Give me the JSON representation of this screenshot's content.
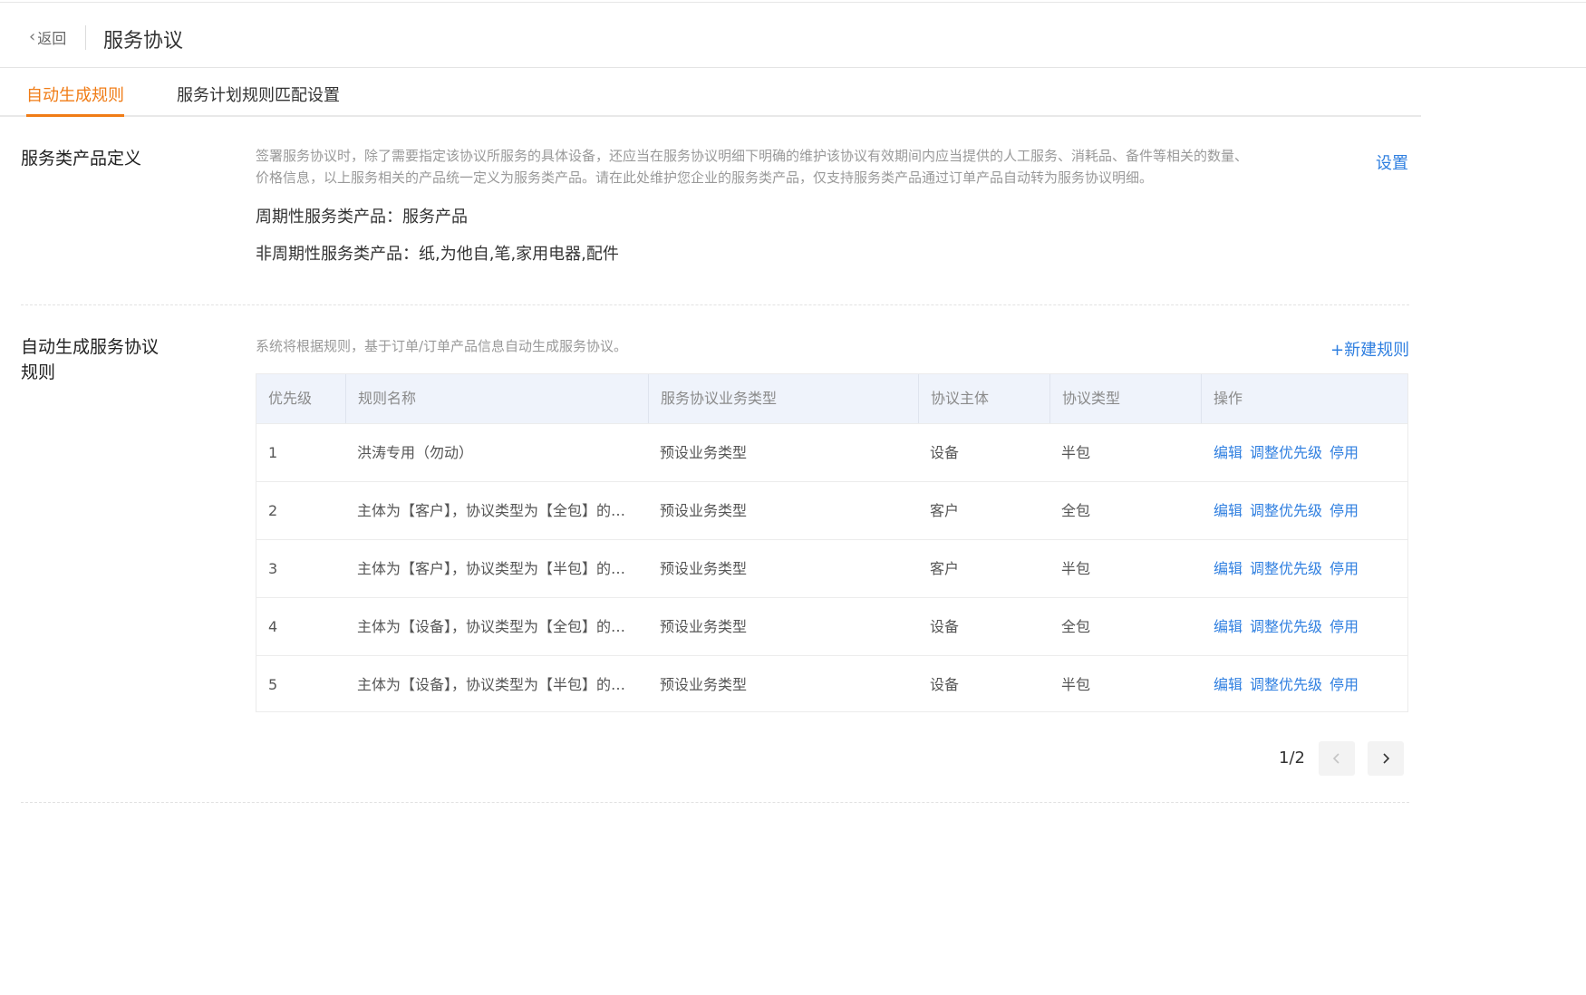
{
  "header": {
    "back_label": "返回",
    "title": "服务协议"
  },
  "tabs": [
    {
      "label": "自动生成规则",
      "active": true
    },
    {
      "label": "服务计划规则匹配设置",
      "active": false
    }
  ],
  "product_section": {
    "label": "服务类产品定义",
    "description_line1": "签署服务协议时，除了需要指定该协议所服务的具体设备，还应当在服务协议明细下明确的维护该协议有效期间内应当提供的人工服务、消耗品、备件等相关的数量、",
    "description_line2": "价格信息，以上服务相关的产品统一定义为服务类产品。请在此处维护您企业的服务类产品，仅支持服务类产品通过订单产品自动转为服务协议明细。",
    "settings_link": "设置",
    "periodic": "周期性服务类产品：服务产品",
    "non_periodic": "非周期性服务类产品：纸,为他自,笔,家用电器,配件"
  },
  "rules_section": {
    "label_line1": "自动生成服务协议",
    "label_line2": "规则",
    "description": "系统将根据规则，基于订单/订单产品信息自动生成服务协议。",
    "new_rule_link": "+新建规则",
    "columns": [
      "优先级",
      "规则名称",
      "服务协议业务类型",
      "协议主体",
      "协议类型",
      "操作"
    ],
    "rows": [
      {
        "priority": "1",
        "name": "洪涛专用（勿动）",
        "business_type": "预设业务类型",
        "subject": "设备",
        "type": "半包"
      },
      {
        "priority": "2",
        "name": "主体为【客户】，协议类型为【全包】的服务协议",
        "business_type": "预设业务类型",
        "subject": "客户",
        "type": "全包"
      },
      {
        "priority": "3",
        "name": "主体为【客户】，协议类型为【半包】的服务协议",
        "business_type": "预设业务类型",
        "subject": "客户",
        "type": "半包"
      },
      {
        "priority": "4",
        "name": "主体为【设备】，协议类型为【全包】的服务协议",
        "business_type": "预设业务类型",
        "subject": "设备",
        "type": "全包"
      },
      {
        "priority": "5",
        "name": "主体为【设备】，协议类型为【半包】的服务协议",
        "business_type": "预设业务类型",
        "subject": "设备",
        "type": "半包"
      }
    ],
    "actions": {
      "edit": "编辑",
      "adjust_priority": "调整优先级",
      "disable": "停用"
    }
  },
  "pagination": {
    "current_page": 1,
    "total_pages": 2,
    "text": "1/2"
  },
  "colors": {
    "accent": "#f07c16",
    "link": "#2f7fe0",
    "header_bg": "#eff3fb"
  }
}
